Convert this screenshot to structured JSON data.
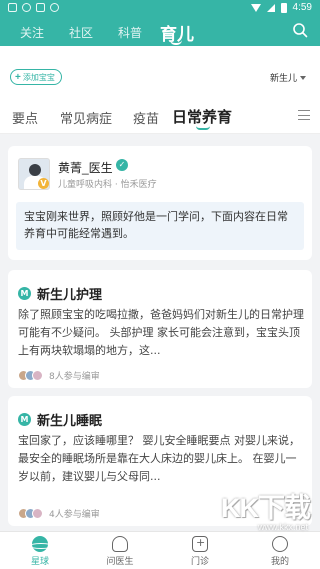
{
  "status_bar": {
    "time": "4:59"
  },
  "top_nav": {
    "tabs": [
      {
        "label": "关注",
        "active": false
      },
      {
        "label": "社区",
        "active": false
      },
      {
        "label": "科普",
        "active": false
      },
      {
        "label": "育儿",
        "active": true
      }
    ]
  },
  "sub_bar": {
    "add_baby_label": "添加宝宝",
    "baby_select_label": "新生儿"
  },
  "category_tabs": {
    "tabs": [
      {
        "label": "要点",
        "active": false
      },
      {
        "label": "常见病症",
        "active": false
      },
      {
        "label": "疫苗",
        "active": false
      },
      {
        "label": "日常养育",
        "active": true
      }
    ]
  },
  "doctor": {
    "name": "黄菁_医生",
    "subtitle": "儿童呼吸内科 · 怡禾医疗",
    "quote": "宝宝刚来世界，照顾好他是一门学问，下面内容在日常养育中可能经常遇到。"
  },
  "articles": [
    {
      "title": "新生儿护理",
      "body": "除了照顾宝宝的吃喝拉撒，爸爸妈妈们对新生儿的日常护理可能有不少疑问。 头部护理 家长可能会注意到，宝宝头顶上有两块软塌塌的地方，这...",
      "footer": "8人参与编审"
    },
    {
      "title": "新生儿睡眠",
      "body": "宝回家了，应该睡哪里？ 婴儿安全睡眠要点 对婴儿来说，最安全的睡眠场所是靠在大人床边的婴儿床上。 在婴儿一岁以前，建议婴儿与父母同...",
      "footer": "4人参与编审"
    }
  ],
  "bottom_nav": {
    "items": [
      {
        "label": "星球",
        "icon": "planet-icon",
        "active": true
      },
      {
        "label": "问医生",
        "icon": "doctor-icon",
        "active": false
      },
      {
        "label": "门诊",
        "icon": "clinic-icon",
        "active": false
      },
      {
        "label": "我的",
        "icon": "profile-icon",
        "active": false
      }
    ]
  },
  "watermark": {
    "text": "KK下载",
    "url": "www.kkx.net"
  },
  "colors": {
    "accent": "#36b5a6",
    "quote_bg": "#eef4fa",
    "page_bg": "#f2f3f5"
  }
}
